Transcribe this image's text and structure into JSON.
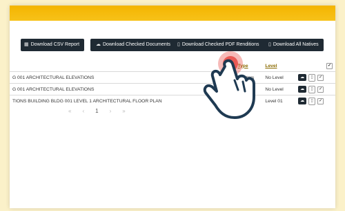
{
  "toolbar": {
    "csv": "Download CSV Report",
    "checked_docs": "Download Checked Documents",
    "checked_pdf": "Download Checked PDF Renditions",
    "all_natives": "Download All Natives"
  },
  "table": {
    "headers": {
      "type": "Type",
      "level": "Level"
    },
    "rows": [
      {
        "name": "G 001 ARCHITECTURAL ELEVATIONS",
        "type": "Masters",
        "level": "No Level"
      },
      {
        "name": "G 001 ARCHITECTURAL ELEVATIONS",
        "type": "Masters",
        "level": "No Level"
      },
      {
        "name": "TIONS BUILDING BLDG 001 LEVEL 1 ARCHITECTURAL FLOOR PLAN",
        "type": "Masters",
        "level": "Level 01"
      }
    ]
  },
  "pager": {
    "first": "«",
    "prev": "‹",
    "page": "1",
    "next": "›",
    "last": "»"
  },
  "colors": {
    "topbar": "#f4b400",
    "button": "#1f2a33",
    "tap": "#e53935"
  },
  "icons": {
    "csv": "spreadsheet-icon",
    "docs": "cloud-download-icon",
    "pdf": "file-icon",
    "natives": "file-icon",
    "hand": "tap-hand-icon"
  }
}
